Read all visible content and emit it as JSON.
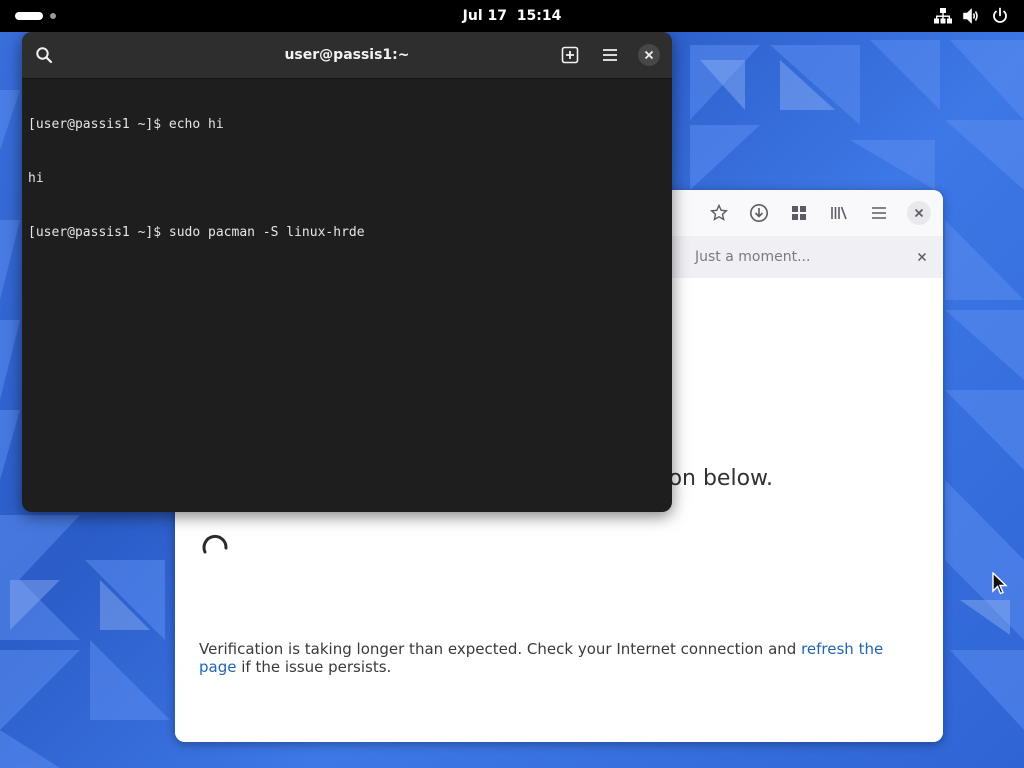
{
  "topbar": {
    "clock_date": "Jul 17",
    "clock_time": "15:14",
    "icons": [
      "network-icon",
      "volume-icon",
      "power-icon"
    ]
  },
  "terminal": {
    "title": "user@passis1:~",
    "header_icons": [
      "search-icon",
      "new-tab-icon",
      "menu-icon",
      "close-icon"
    ],
    "lines": [
      "[user@passis1 ~]$ echo hi",
      "hi",
      "[user@passis1 ~]$ sudo pacman -S linux-hrde"
    ]
  },
  "browser": {
    "toolbar_icons": [
      "bookmark-star-icon",
      "downloads-icon",
      "extensions-icon",
      "library-icon",
      "menu-icon",
      "close-icon"
    ],
    "tab_title": "Just a moment...",
    "heading_visible": "on below.",
    "message_before_link": "Verification is taking longer than expected. Check your Internet connection and ",
    "message_link": "refresh the page",
    "message_after_link": " if the issue persists."
  },
  "colors": {
    "wallpaper_blue": "#2f63d0",
    "terminal_bg": "#1e1e1e",
    "link_blue": "#1f64b8"
  }
}
